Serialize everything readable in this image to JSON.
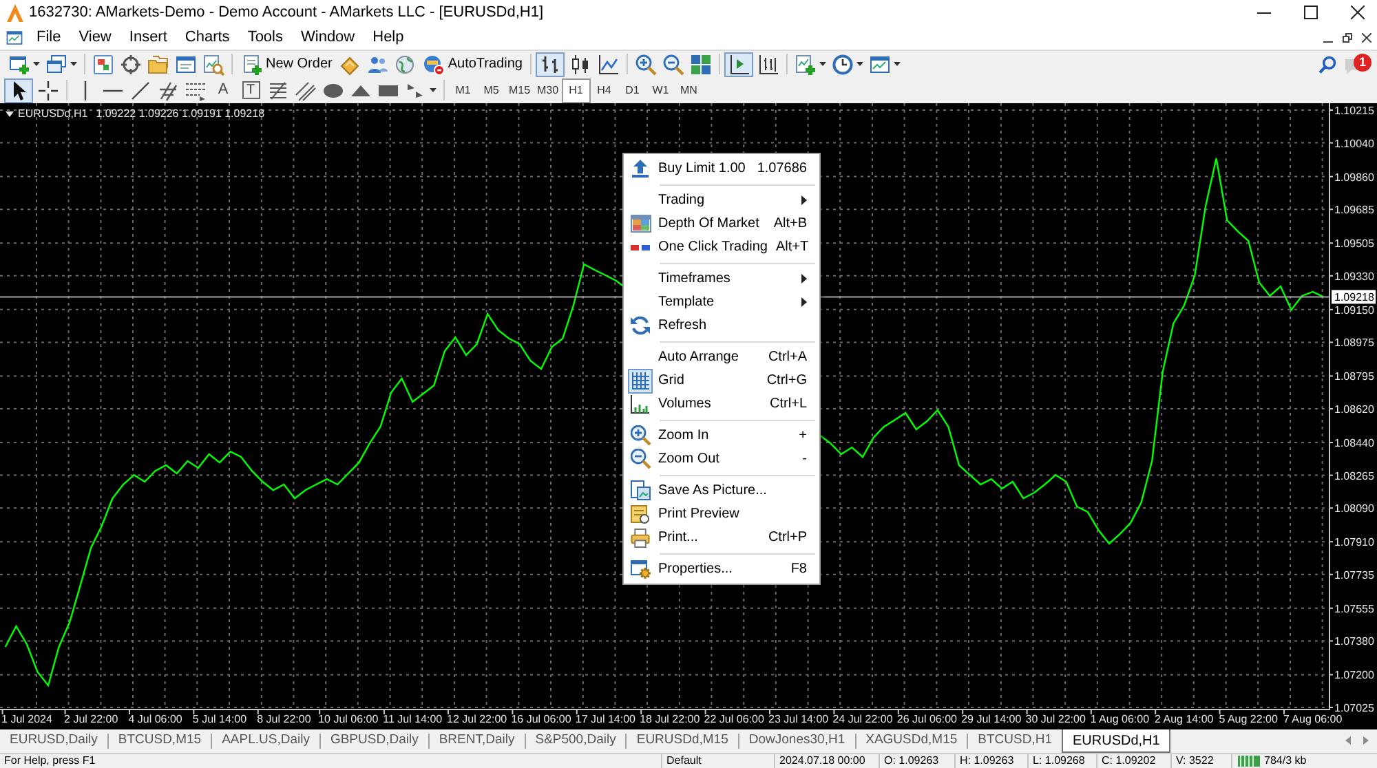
{
  "window": {
    "title": "1632730: AMarkets-Demo - Demo Account - AMarkets LLC - [EURUSDd,H1]"
  },
  "menu": [
    "File",
    "View",
    "Insert",
    "Charts",
    "Tools",
    "Window",
    "Help"
  ],
  "toolbar": {
    "new_order": "New Order",
    "auto_trading": "AutoTrading",
    "chart_types": [
      {
        "kind": "bars",
        "selected": true
      },
      {
        "kind": "candles",
        "selected": false
      },
      {
        "kind": "line",
        "selected": false
      }
    ],
    "auto_scroll": {
      "on": true
    },
    "chart_shift": {
      "on": false
    },
    "notifications": "1"
  },
  "drawing_toolbar": {
    "pointer_tools": [
      {
        "kind": "cursor",
        "selected": true
      },
      {
        "kind": "crosshair",
        "selected": false
      }
    ],
    "text_tools": [
      {
        "kind": "text",
        "label": "A"
      },
      {
        "kind": "label",
        "label": "T"
      }
    ],
    "timeframes": [
      {
        "label": "M1",
        "selected": false
      },
      {
        "label": "M5",
        "selected": false
      },
      {
        "label": "M15",
        "selected": false
      },
      {
        "label": "M30",
        "selected": false
      },
      {
        "label": "H1",
        "selected": true
      },
      {
        "label": "H4",
        "selected": false
      },
      {
        "label": "D1",
        "selected": false
      },
      {
        "label": "W1",
        "selected": false
      },
      {
        "label": "MN",
        "selected": false
      }
    ]
  },
  "chart": {
    "symbol": "EURUSDd,H1",
    "quotes": "1.09222 1.09226 1.09191 1.09218",
    "chart_data": {
      "type": "line",
      "grid": true,
      "categories": [
        null,
        null,
        "1 Jul 2024",
        null,
        null,
        null,
        null,
        null,
        "2 Jul 22:00",
        null,
        null,
        null,
        null,
        null,
        "4 Jul 06:00",
        null,
        null,
        null,
        null,
        null,
        "5 Jul 14:00",
        null,
        null,
        null,
        null,
        null,
        "8 Jul 22:00",
        null,
        null,
        null,
        null,
        null,
        "10 Jul 06:00",
        null,
        null,
        null,
        null,
        null,
        "11 Jul 14:00",
        null,
        null,
        null,
        null,
        null,
        "12 Jul 22:00",
        null,
        null,
        null,
        null,
        null,
        "16 Jul 06:00",
        null,
        null,
        null,
        null,
        null,
        "17 Jul 14:00",
        null,
        null,
        null,
        null,
        null,
        "18 Jul 22:00",
        null,
        null,
        null,
        null,
        null,
        "22 Jul 06:00",
        null,
        null,
        null,
        null,
        null,
        "23 Jul 14:00",
        null,
        null,
        null,
        null,
        null,
        "24 Jul 22:00",
        null,
        null,
        null,
        null,
        null,
        "26 Jul 06:00",
        null,
        null,
        null,
        null,
        null,
        "29 Jul 14:00",
        null,
        null,
        null,
        null,
        null,
        "30 Jul 22:00",
        null,
        null,
        null,
        null,
        null,
        "1 Aug 06:00",
        null,
        null,
        null,
        null,
        null,
        "2 Aug 14:00",
        null,
        null,
        null,
        null,
        null,
        "5 Aug 22:00",
        null,
        null,
        null,
        null,
        null,
        "7 Aug 06:00",
        null
      ],
      "ylim": [
        1.07018,
        1.10252
      ],
      "yticks": [
        {
          "value": 1.07025,
          "label": "1.07025"
        },
        {
          "value": 1.072,
          "label": "1.07200"
        },
        {
          "value": 1.0738,
          "label": "1.07380"
        },
        {
          "value": 1.07555,
          "label": "1.07555"
        },
        {
          "value": 1.07735,
          "label": "1.07735"
        },
        {
          "value": 1.0791,
          "label": "1.07910"
        },
        {
          "value": 1.0809,
          "label": "1.08090"
        },
        {
          "value": 1.08265,
          "label": "1.08265"
        },
        {
          "value": 1.0844,
          "label": "1.08440"
        },
        {
          "value": 1.0862,
          "label": "1.08620"
        },
        {
          "value": 1.08795,
          "label": "1.08795"
        },
        {
          "value": 1.08975,
          "label": "1.08975"
        },
        {
          "value": 1.0915,
          "label": "1.09150"
        },
        {
          "value": 1.0933,
          "label": "1.09330"
        },
        {
          "value": 1.09505,
          "label": "1.09505"
        },
        {
          "value": 1.09685,
          "label": "1.09685"
        },
        {
          "value": 1.0986,
          "label": "1.09860"
        },
        {
          "value": 1.1004,
          "label": "1.10040"
        },
        {
          "value": 1.10215,
          "label": "1.10215"
        }
      ],
      "series": [
        {
          "color": "#00ff00",
          "values": [
            1.07349,
            1.07459,
            1.07363,
            1.07216,
            1.07143,
            1.07349,
            1.07481,
            1.07679,
            1.07878,
            1.07995,
            1.08142,
            1.08216,
            1.08267,
            1.08231,
            1.08289,
            1.08319,
            1.08275,
            1.08341,
            1.08304,
            1.08378,
            1.08333,
            1.08392,
            1.08363,
            1.08289,
            1.08231,
            1.08186,
            1.08216,
            1.08142,
            1.08186,
            1.08216,
            1.08245,
            1.08216,
            1.08275,
            1.08333,
            1.08436,
            1.08525,
            1.08708,
            1.08782,
            1.08657,
            1.08701,
            1.08745,
            1.08929,
            1.09002,
            1.08907,
            1.08966,
            1.09127,
            1.09039,
            1.08995,
            1.08966,
            1.08877,
            1.08833,
            1.08951,
            1.08995,
            1.09171,
            1.09392,
            1.09362,
            1.09333,
            1.09304,
            null,
            null,
            null,
            null,
            null,
            null,
            null,
            null,
            null,
            null,
            null,
            null,
            null,
            null,
            null,
            null,
            null,
            null,
            null,
            1.08436,
            1.08378,
            1.08414,
            1.08363,
            1.08466,
            1.08525,
            1.08561,
            1.08598,
            1.0851,
            1.08554,
            1.08613,
            1.08525,
            1.08319,
            1.08267,
            1.08216,
            1.08245,
            1.08194,
            1.08231,
            1.08142,
            1.08172,
            1.08216,
            1.08267,
            1.08231,
            1.08098,
            1.08069,
            1.07973,
            1.079,
            1.07951,
            1.0801,
            1.0812,
            1.08341,
            1.08819,
            1.09076,
            1.09171,
            1.09333,
            1.09701,
            1.09958,
            1.09627,
            1.09568,
            1.09517,
            1.09296,
            1.09223,
            1.09274,
            1.09149,
            1.09223,
            1.09245,
            1.09218
          ]
        }
      ],
      "ref_lines": [
        {
          "axis": "y",
          "value": 1.09218,
          "label": "1.09218"
        }
      ]
    }
  },
  "context_menu": {
    "groups": [
      [
        {
          "label": "Buy Limit 1.00",
          "price": "1.07686",
          "submenu": false,
          "checked": false
        }
      ],
      [
        {
          "label": "Trading",
          "submenu": true,
          "checked": false
        },
        {
          "label": "Depth Of Market",
          "shortcut": "Alt+B",
          "submenu": false,
          "checked": false
        },
        {
          "label": "One Click Trading",
          "shortcut": "Alt+T",
          "submenu": false,
          "checked": false
        }
      ],
      [
        {
          "label": "Timeframes",
          "submenu": true,
          "checked": false
        },
        {
          "label": "Template",
          "submenu": true,
          "checked": false
        },
        {
          "label": "Refresh",
          "submenu": false,
          "checked": false
        }
      ],
      [
        {
          "label": "Auto Arrange",
          "shortcut": "Ctrl+A",
          "submenu": false,
          "checked": false
        },
        {
          "label": "Grid",
          "shortcut": "Ctrl+G",
          "submenu": false,
          "checked": true
        },
        {
          "label": "Volumes",
          "shortcut": "Ctrl+L",
          "submenu": false,
          "checked": false
        }
      ],
      [
        {
          "label": "Zoom In",
          "shortcut": "+",
          "submenu": false,
          "checked": false
        },
        {
          "label": "Zoom Out",
          "shortcut": "-",
          "submenu": false,
          "checked": false
        }
      ],
      [
        {
          "label": "Save As Picture...",
          "submenu": false,
          "checked": false
        },
        {
          "label": "Print Preview",
          "submenu": false,
          "checked": false
        },
        {
          "label": "Print...",
          "shortcut": "Ctrl+P",
          "submenu": false,
          "checked": false
        }
      ],
      [
        {
          "label": "Properties...",
          "shortcut": "F8",
          "submenu": false,
          "checked": false
        }
      ]
    ]
  },
  "tabs": [
    {
      "label": "EURUSD,Daily",
      "selected": false
    },
    {
      "label": "BTCUSD,M15",
      "selected": false
    },
    {
      "label": "AAPL.US,Daily",
      "selected": false
    },
    {
      "label": "GBPUSD,Daily",
      "selected": false
    },
    {
      "label": "BRENT,Daily",
      "selected": false
    },
    {
      "label": "S&P500,Daily",
      "selected": false
    },
    {
      "label": "EURUSDd,M15",
      "selected": false
    },
    {
      "label": "DowJones30,H1",
      "selected": false
    },
    {
      "label": "XAGUSDd,M15",
      "selected": false
    },
    {
      "label": "BTCUSD,H1",
      "selected": false
    },
    {
      "label": "EURUSDd,H1",
      "selected": true
    }
  ],
  "status_bar": {
    "help": "For Help, press F1",
    "profile": "Default",
    "time": "2024.07.18 00:00",
    "open": "O: 1.09263",
    "high": "H: 1.09263",
    "low": "L: 1.09268",
    "close": "C: 1.09202",
    "volume": "V: 3522",
    "traffic": "784/3 kb"
  }
}
